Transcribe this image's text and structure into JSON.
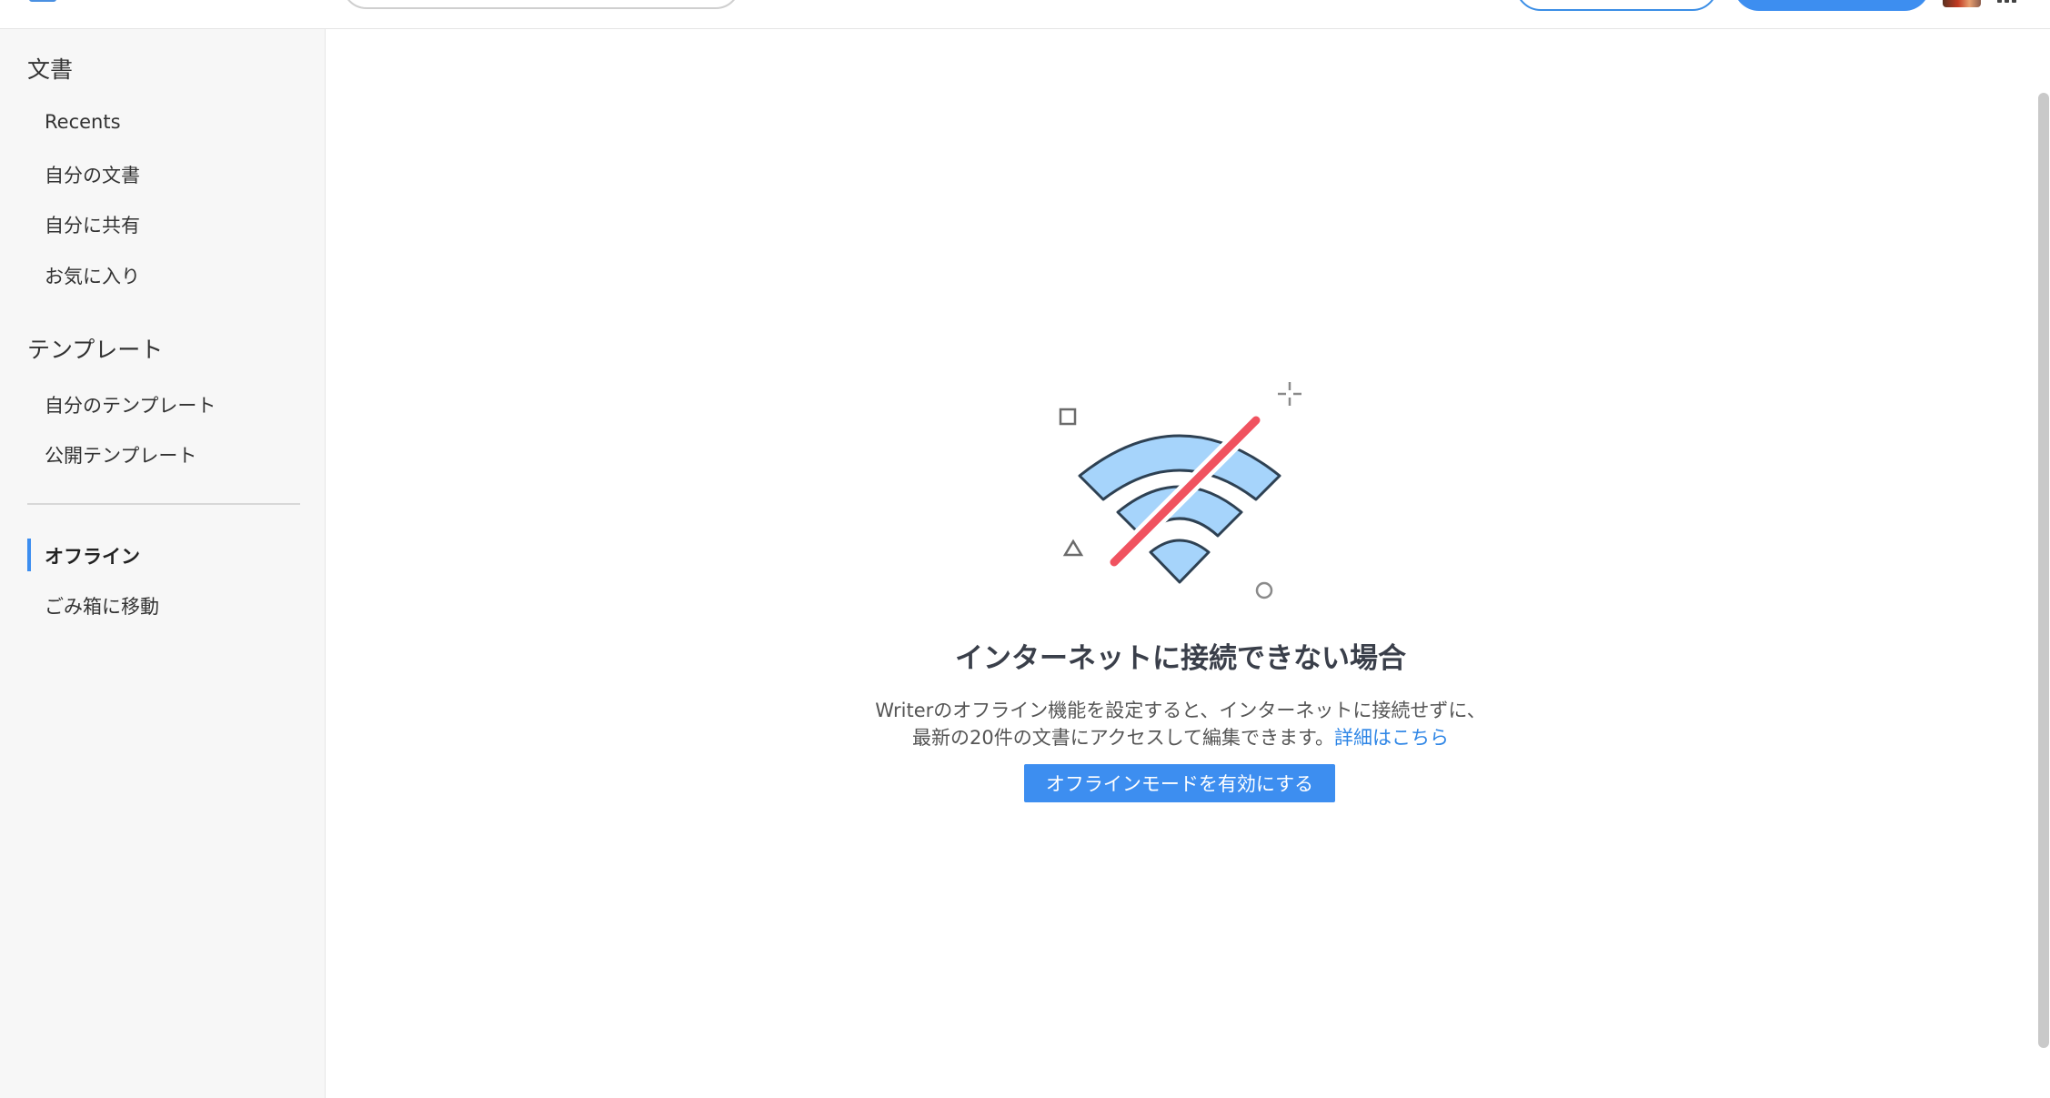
{
  "sidebar": {
    "documents_title": "文書",
    "documents_items": [
      {
        "label": "Recents"
      },
      {
        "label": "自分の文書"
      },
      {
        "label": "自分に共有"
      },
      {
        "label": "お気に入り"
      }
    ],
    "templates_title": "テンプレート",
    "templates_items": [
      {
        "label": "自分のテンプレート"
      },
      {
        "label": "公開テンプレート"
      }
    ],
    "offline_label": "オフライン",
    "trash_label": "ごみ箱に移動"
  },
  "main": {
    "heading": "インターネットに接続できない場合",
    "description_line1": "Writerのオフライン機能を設定すると、インターネットに接続せずに、",
    "description_line2": "最新の20件の文書にアクセスして編集できます。",
    "learn_more_link": "詳細はこちら",
    "enable_button": "オフラインモードを有効にする"
  },
  "colors": {
    "accent": "#3d8ef0",
    "link": "#2f86e6",
    "wifi_fill": "#a6d4fb",
    "wifi_stroke": "#2e4153",
    "slash": "#f0525f"
  },
  "icons": {
    "illustration": "wifi-off-icon",
    "apps": "apps-grid-icon"
  }
}
